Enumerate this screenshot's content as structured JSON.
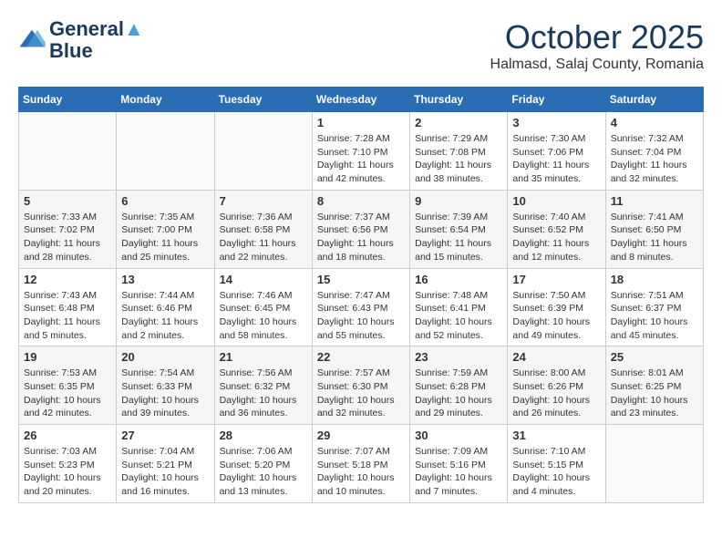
{
  "logo": {
    "line1": "General",
    "line2": "Blue"
  },
  "title": "October 2025",
  "subtitle": "Halmasd, Salaj County, Romania",
  "days_of_week": [
    "Sunday",
    "Monday",
    "Tuesday",
    "Wednesday",
    "Thursday",
    "Friday",
    "Saturday"
  ],
  "weeks": [
    [
      {
        "num": "",
        "info": ""
      },
      {
        "num": "",
        "info": ""
      },
      {
        "num": "",
        "info": ""
      },
      {
        "num": "1",
        "info": "Sunrise: 7:28 AM\nSunset: 7:10 PM\nDaylight: 11 hours and 42 minutes."
      },
      {
        "num": "2",
        "info": "Sunrise: 7:29 AM\nSunset: 7:08 PM\nDaylight: 11 hours and 38 minutes."
      },
      {
        "num": "3",
        "info": "Sunrise: 7:30 AM\nSunset: 7:06 PM\nDaylight: 11 hours and 35 minutes."
      },
      {
        "num": "4",
        "info": "Sunrise: 7:32 AM\nSunset: 7:04 PM\nDaylight: 11 hours and 32 minutes."
      }
    ],
    [
      {
        "num": "5",
        "info": "Sunrise: 7:33 AM\nSunset: 7:02 PM\nDaylight: 11 hours and 28 minutes."
      },
      {
        "num": "6",
        "info": "Sunrise: 7:35 AM\nSunset: 7:00 PM\nDaylight: 11 hours and 25 minutes."
      },
      {
        "num": "7",
        "info": "Sunrise: 7:36 AM\nSunset: 6:58 PM\nDaylight: 11 hours and 22 minutes."
      },
      {
        "num": "8",
        "info": "Sunrise: 7:37 AM\nSunset: 6:56 PM\nDaylight: 11 hours and 18 minutes."
      },
      {
        "num": "9",
        "info": "Sunrise: 7:39 AM\nSunset: 6:54 PM\nDaylight: 11 hours and 15 minutes."
      },
      {
        "num": "10",
        "info": "Sunrise: 7:40 AM\nSunset: 6:52 PM\nDaylight: 11 hours and 12 minutes."
      },
      {
        "num": "11",
        "info": "Sunrise: 7:41 AM\nSunset: 6:50 PM\nDaylight: 11 hours and 8 minutes."
      }
    ],
    [
      {
        "num": "12",
        "info": "Sunrise: 7:43 AM\nSunset: 6:48 PM\nDaylight: 11 hours and 5 minutes."
      },
      {
        "num": "13",
        "info": "Sunrise: 7:44 AM\nSunset: 6:46 PM\nDaylight: 11 hours and 2 minutes."
      },
      {
        "num": "14",
        "info": "Sunrise: 7:46 AM\nSunset: 6:45 PM\nDaylight: 10 hours and 58 minutes."
      },
      {
        "num": "15",
        "info": "Sunrise: 7:47 AM\nSunset: 6:43 PM\nDaylight: 10 hours and 55 minutes."
      },
      {
        "num": "16",
        "info": "Sunrise: 7:48 AM\nSunset: 6:41 PM\nDaylight: 10 hours and 52 minutes."
      },
      {
        "num": "17",
        "info": "Sunrise: 7:50 AM\nSunset: 6:39 PM\nDaylight: 10 hours and 49 minutes."
      },
      {
        "num": "18",
        "info": "Sunrise: 7:51 AM\nSunset: 6:37 PM\nDaylight: 10 hours and 45 minutes."
      }
    ],
    [
      {
        "num": "19",
        "info": "Sunrise: 7:53 AM\nSunset: 6:35 PM\nDaylight: 10 hours and 42 minutes."
      },
      {
        "num": "20",
        "info": "Sunrise: 7:54 AM\nSunset: 6:33 PM\nDaylight: 10 hours and 39 minutes."
      },
      {
        "num": "21",
        "info": "Sunrise: 7:56 AM\nSunset: 6:32 PM\nDaylight: 10 hours and 36 minutes."
      },
      {
        "num": "22",
        "info": "Sunrise: 7:57 AM\nSunset: 6:30 PM\nDaylight: 10 hours and 32 minutes."
      },
      {
        "num": "23",
        "info": "Sunrise: 7:59 AM\nSunset: 6:28 PM\nDaylight: 10 hours and 29 minutes."
      },
      {
        "num": "24",
        "info": "Sunrise: 8:00 AM\nSunset: 6:26 PM\nDaylight: 10 hours and 26 minutes."
      },
      {
        "num": "25",
        "info": "Sunrise: 8:01 AM\nSunset: 6:25 PM\nDaylight: 10 hours and 23 minutes."
      }
    ],
    [
      {
        "num": "26",
        "info": "Sunrise: 7:03 AM\nSunset: 5:23 PM\nDaylight: 10 hours and 20 minutes."
      },
      {
        "num": "27",
        "info": "Sunrise: 7:04 AM\nSunset: 5:21 PM\nDaylight: 10 hours and 16 minutes."
      },
      {
        "num": "28",
        "info": "Sunrise: 7:06 AM\nSunset: 5:20 PM\nDaylight: 10 hours and 13 minutes."
      },
      {
        "num": "29",
        "info": "Sunrise: 7:07 AM\nSunset: 5:18 PM\nDaylight: 10 hours and 10 minutes."
      },
      {
        "num": "30",
        "info": "Sunrise: 7:09 AM\nSunset: 5:16 PM\nDaylight: 10 hours and 7 minutes."
      },
      {
        "num": "31",
        "info": "Sunrise: 7:10 AM\nSunset: 5:15 PM\nDaylight: 10 hours and 4 minutes."
      },
      {
        "num": "",
        "info": ""
      }
    ]
  ]
}
